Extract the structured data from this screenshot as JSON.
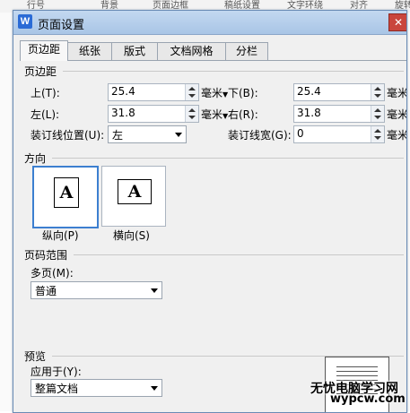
{
  "background": {
    "toolbar_items": [
      "行号",
      "背景",
      "页面边框",
      "稿纸设置",
      "文字环绕",
      "对齐",
      "旋转"
    ]
  },
  "dialog": {
    "title": "页面设置",
    "app_icon_letter": "W",
    "close_glyph": "✕",
    "tabs": [
      "页边距",
      "纸张",
      "版式",
      "文档网格",
      "分栏"
    ],
    "active_tab": "页边距"
  },
  "margins": {
    "group_title": "页边距",
    "top_label": "上(T):",
    "top_value": "25.4",
    "bottom_label": "下(B):",
    "bottom_value": "25.4",
    "left_label": "左(L):",
    "left_value": "31.8",
    "right_label": "右(R):",
    "right_value": "31.8",
    "gutter_pos_label": "装订线位置(U):",
    "gutter_pos_value": "左",
    "gutter_width_label": "装订线宽(G):",
    "gutter_width_value": "0",
    "unit_label": "毫米"
  },
  "orientation": {
    "group_title": "方向",
    "portrait_label": "纵向(P)",
    "landscape_label": "横向(S)",
    "page_glyph": "A",
    "selected": "portrait"
  },
  "page_range": {
    "group_title": "页码范围",
    "multiple_pages_label": "多页(M):",
    "multiple_pages_value": "普通"
  },
  "preview": {
    "group_title": "预览",
    "apply_to_label": "应用于(Y):",
    "apply_to_value": "整篇文档"
  },
  "watermark": {
    "line1": "无忧电脑学习网",
    "line2": "wypcw.com"
  },
  "colors": {
    "title_bar": "#b5cfee",
    "close_button": "#c9463d",
    "selection_border": "#3c7fd0"
  }
}
